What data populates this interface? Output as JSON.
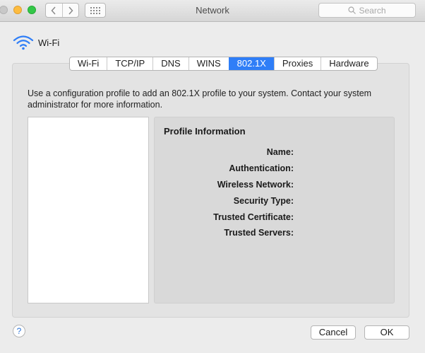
{
  "window": {
    "title": "Network",
    "search_placeholder": "Search"
  },
  "header": {
    "network_name": "Wi-Fi",
    "icon": "wifi-icon"
  },
  "tabs": [
    {
      "label": "Wi-Fi",
      "active": false
    },
    {
      "label": "TCP/IP",
      "active": false
    },
    {
      "label": "DNS",
      "active": false
    },
    {
      "label": "WINS",
      "active": false
    },
    {
      "label": "802.1X",
      "active": true
    },
    {
      "label": "Proxies",
      "active": false
    },
    {
      "label": "Hardware",
      "active": false
    }
  ],
  "main": {
    "description": "Use a configuration profile to add an 802.1X profile to your system. Contact your system administrator for more information.",
    "profile_info": {
      "title": "Profile Information",
      "rows": [
        {
          "label": "Name:"
        },
        {
          "label": "Authentication:"
        },
        {
          "label": "Wireless Network:"
        },
        {
          "label": "Security Type:"
        },
        {
          "label": "Trusted Certificate:"
        },
        {
          "label": "Trusted Servers:"
        }
      ]
    }
  },
  "footer": {
    "help": "?",
    "cancel_label": "Cancel",
    "ok_label": "OK"
  },
  "colors": {
    "accent": "#2f7ef7",
    "window_bg": "#ececec"
  }
}
